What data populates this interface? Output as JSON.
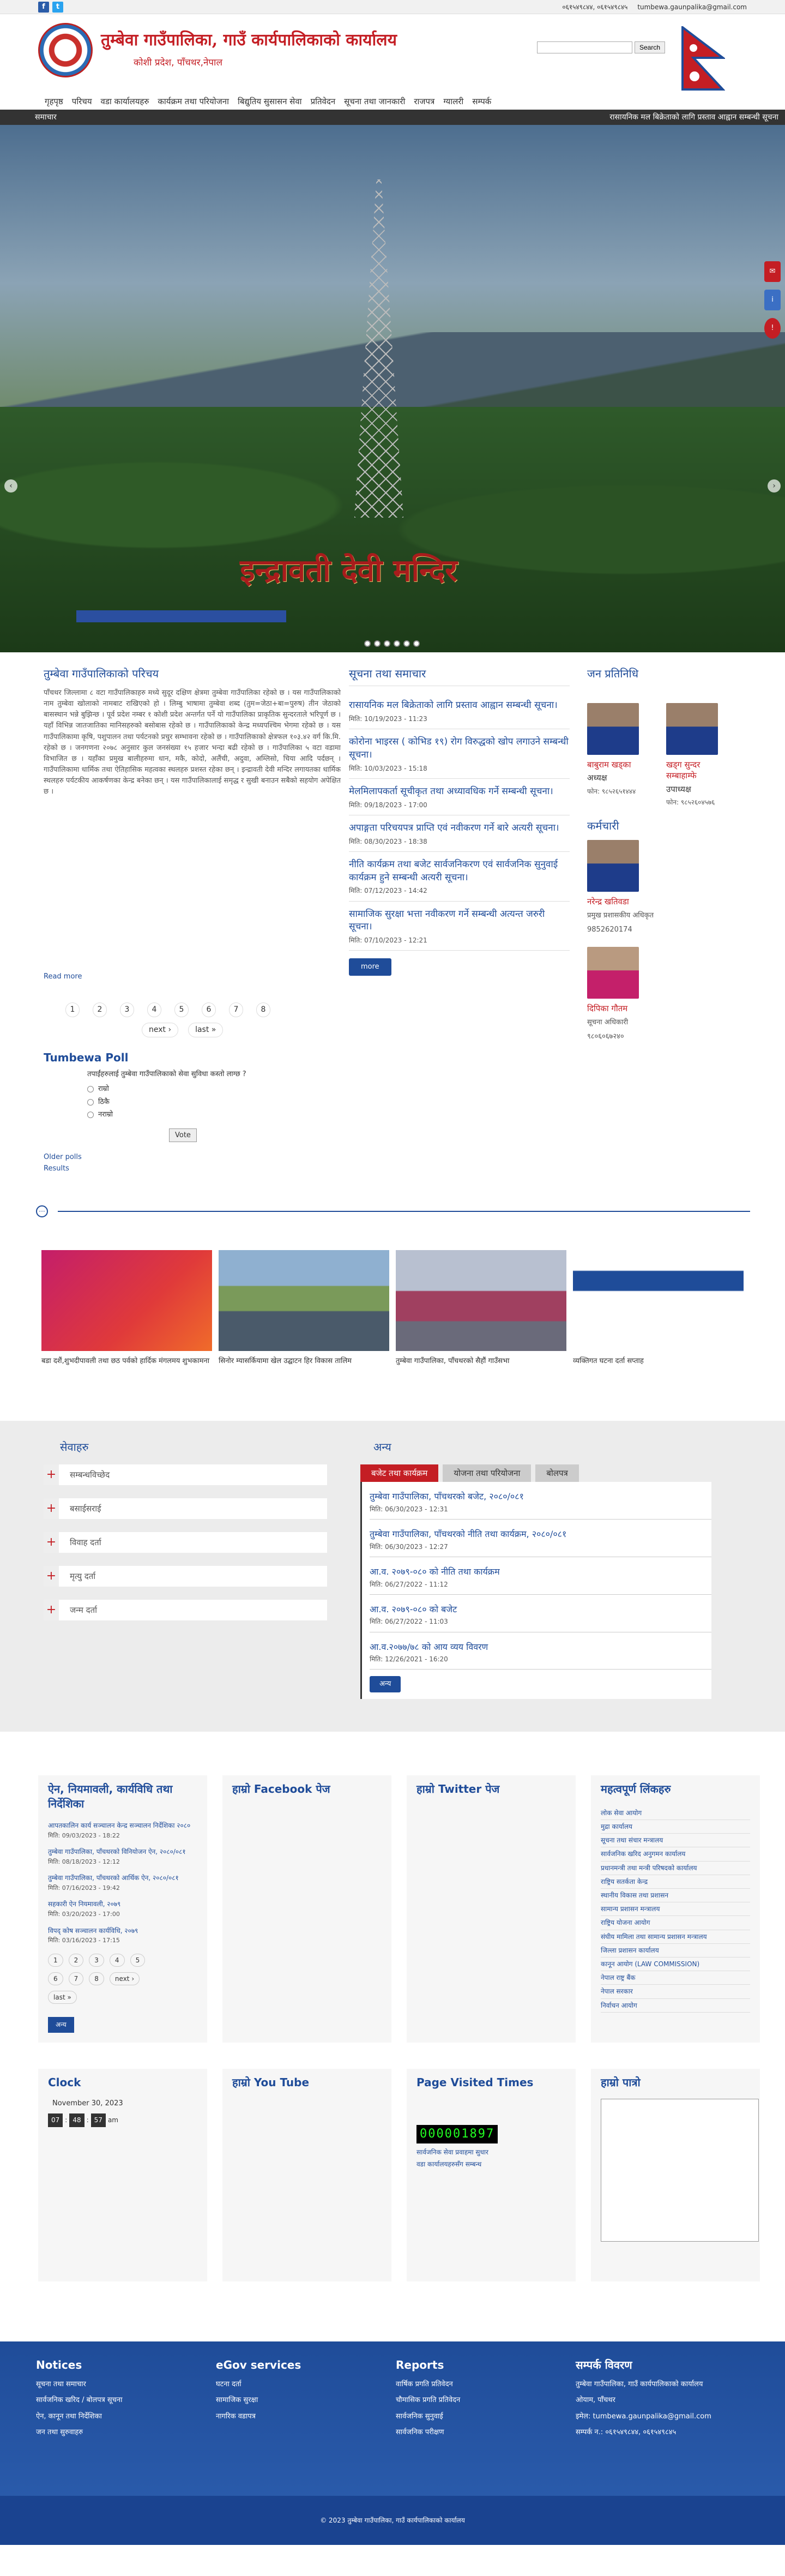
{
  "topbar": {
    "phone": "०६१५४९८४४, ०६१५४९८४५",
    "email": "tumbewa.gaunpalika@gmail.com"
  },
  "header": {
    "title": "तुम्बेवा गाउँपालिका, गाउँ कार्यपालिकाको कार्यालय",
    "subtitle": "कोशी प्रदेश, पाँचथर,नेपाल",
    "search_button": "Search"
  },
  "nav": [
    "गृहपृष्ठ",
    "परिचय",
    "वडा कार्यालयहरु",
    "कार्यक्रम तथा परियोजना",
    "बिद्युतिय सुसासन सेवा",
    "प्रतिवेदन",
    "सूचना तथा जानकारी",
    "राजपत्र",
    "ग्यालरी",
    "सम्पर्क"
  ],
  "ticker": {
    "label": "समाचार",
    "text": "रासायनिक मल बिक्रेताको लागि प्रस्ताव आह्वान सम्बन्धी सूचना"
  },
  "hero": {
    "caption": "इन्द्रावती देवी मन्दिर"
  },
  "intro": {
    "heading": "तुम्बेवा गाउँपालिकाको परिचय",
    "text": "पाँचथर जिल्लामा ८ वटा गाउँपालिकाहरु मध्ये सुदूर दक्षिण क्षेत्रमा तुम्बेवा गाउँपालिका रहेको छ । यस गाउँपालिकाको नाम तुम्बेवा खोलाको नामबाट राखिएको हो । लिम्बु भाषामा तुम्बेवा शब्द (तुम=जेठा+बा=पुरुष) तीन जेठाको बासस्थान भन्ने बुझिन्छ । पूर्व प्रदेश नम्बर १ कोशी प्रदेश अन्तर्गत पर्ने यो गाउँपालिका प्राकृतिक सुन्दरताले भरिपूर्ण छ । यहाँ विभिन्न जातजातिका मानिसहरुको बसोबास रहेको छ । गाउँपालिकाको केन्द्र मध्यपश्चिम भेगमा रहेको छ । यस गाउँपालिकामा कृषि, पशुपालन तथा पर्यटनको प्रचुर सम्भावना रहेको छ । गाउँपालिकाको क्षेत्रफल १०३.४२ वर्ग कि.मि. रहेको छ । जनगणना २०७८ अनुसार कुल जनसंख्या १५ हजार भन्दा बढी रहेको छ । गाउँपालिका ५ वटा वडामा विभाजित छ । यहाँका प्रमुख बालीहरुमा धान, मकै, कोदो, अलैंची, अदुवा, अम्लिसो, चिया आदि पर्दछन् । गाउँपालिकामा धार्मिक तथा ऐतिहासिक महत्वका स्थलहरु प्रशस्त रहेका छन् । इन्द्रावती देवी मन्दिर लगायतका धार्मिक स्थलहरु पर्यटकीय आकर्षणका केन्द्र बनेका छन् । यस गाउँपालिकालाई समृद्ध र सुखी बनाउन सबैको सहयोग अपेक्षित छ ।",
    "more": "Read more"
  },
  "pager": {
    "pages": [
      "1",
      "2",
      "3",
      "4",
      "5",
      "6",
      "7",
      "8"
    ],
    "next": "next ›",
    "last": "last »"
  },
  "poll": {
    "heading": "Tumbewa Poll",
    "question": "तपाईंहरुलाई तुम्बेवा गाउँपालिकाको सेवा सुविधा कस्तो लाग्छ ?",
    "options": [
      "राम्रो",
      "ठिकै",
      "नराम्रो"
    ],
    "vote": "Vote",
    "older": "Older polls",
    "results": "Results"
  },
  "news": {
    "heading": "सूचना तथा समाचार",
    "items": [
      {
        "t": "रासायनिक मल बिक्रेताको लागि प्रस्ताव आह्वान सम्बन्धी सूचना।",
        "d": "मिति: 10/19/2023 - 11:23"
      },
      {
        "t": "कोरोना भाइरस ( कोभिड १९) रोग विरुद्धको खोप लगाउने सम्बन्धी सूचना।",
        "d": "मिति: 10/03/2023 - 15:18"
      },
      {
        "t": "मेलमिलापकर्ता सूचीकृत तथा अध्यावधिक गर्ने सम्बन्धी सूचना।",
        "d": "मिति: 09/18/2023 - 17:00"
      },
      {
        "t": "अपाङ्गता परिचयपत्र प्राप्ति एवं नवीकरण गर्ने बारे अत्यरी सूचना।",
        "d": "मिति: 08/30/2023 - 18:38"
      },
      {
        "t": "नीति कार्यक्रम तथा बजेट सार्वजनिकरण एवं सार्वजनिक सुनुवाई कार्यक्रम हुने सम्बन्धी अत्यरी सूचना।",
        "d": "मिति: 07/12/2023 - 14:42"
      },
      {
        "t": "सामाजिक सुरक्षा भत्ता नवीकरण गर्ने सम्बन्धी अत्यन्त जरुरी सूचना।",
        "d": "मिति: 07/10/2023 - 12:21"
      }
    ],
    "more": "more"
  },
  "reps": {
    "heading": "जन प्रतिनिधि",
    "people": [
      {
        "name": "बाबुराम खड्का",
        "post": "अध्यक्ष",
        "phone": "फोन: ९८५२६५१४४४"
      },
      {
        "name": "खड्ग सुन्दर सम्बाहाम्फे",
        "post": "उपाध्यक्ष",
        "phone": "फोन: ९८५२६०४५७६"
      }
    ]
  },
  "staff": {
    "heading": "कर्मचारी",
    "people": [
      {
        "name": "नरेन्द्र खतिवडा",
        "post": "प्रमुख प्रशासकीय अधिकृत",
        "phone": "9852620174"
      },
      {
        "name": "दिपिका गौतम",
        "post": "सूचना अधिकारी",
        "phone": "९८०६०६७२४०"
      }
    ]
  },
  "gallery": [
    {
      "c": "बडा दशैं,शुभदीपावली तथा छठ पर्वको हार्दिक मंगलमय शुभकामना"
    },
    {
      "c": "सिनोर म्यासर्कियामा खेल उद्घाटन हिर विकास तालिम"
    },
    {
      "c": "तुम्बेवा गाउँपालिका, पाँचथरको सैहौं गाउँसभा"
    },
    {
      "c": "व्यक्तिगत घटना दर्ता सप्ताह"
    }
  ],
  "services": {
    "heading": "सेवाहरु",
    "items": [
      "सम्बन्धविच्छेद",
      "बसाईसराई",
      "विवाह दर्ता",
      "मृत्यु दर्ता",
      "जन्म दर्ता"
    ]
  },
  "other": {
    "heading": "अन्य",
    "tabs": [
      "बजेट तथा कार्यक्रम",
      "योजना तथा परियोजना",
      "बोलपत्र"
    ],
    "items": [
      {
        "t": "तुम्बेवा गाउँपालिका, पाँचथरको बजेट, २०८०/०८१",
        "d": "मिति: 06/30/2023 - 12:31"
      },
      {
        "t": "तुम्बेवा गाउँपालिका, पाँचथरको नीति तथा कार्यक्रम, २०८०/०८१",
        "d": "मिति: 06/30/2023 - 12:27"
      },
      {
        "t": "आ.व. २०७९-०८० को नीति तथा कार्यक्रम",
        "d": "मिति: 06/27/2022 - 11:12"
      },
      {
        "t": "आ.व. २०७९-०८० को बजेट",
        "d": "मिति: 06/27/2022 - 11:03"
      },
      {
        "t": "आ.व.२०७७/७८ को आय व्यय विवरण",
        "d": "मिति: 12/26/2021 - 16:20"
      }
    ],
    "btn": "अन्य"
  },
  "laws": {
    "heading": "ऐन, नियमावली, कार्यविधि तथा निर्देशिका",
    "items": [
      {
        "t": "आपतकालिन कार्य सञ्चालन केन्द्र सञ्चालन निर्देशिका २०८०",
        "d": "मिति: 09/03/2023 - 18:22"
      },
      {
        "t": "तुम्बेवा गाउँपालिका, पाँचथरको विनियोजन ऐन, २०८०/०८१",
        "d": "मिति: 08/18/2023 - 12:12"
      },
      {
        "t": "तुम्बेवा गाउँपालिका, पाँचथरको आर्थिक ऐन, २०८०/०८१",
        "d": "मिति: 07/16/2023 - 19:42"
      },
      {
        "t": "सहकारी ऐन नियमावली, २०७९",
        "d": "मिति: 03/20/2023 - 17:00"
      },
      {
        "t": "विपद् कोष सञ्चालन कार्यविधि, २०७९",
        "d": "मिति: 03/16/2023 - 17:15"
      }
    ],
    "pages": [
      "1",
      "2",
      "3",
      "4",
      "5",
      "6",
      "7",
      "8",
      "next ›",
      "last »"
    ],
    "btn": "अन्य"
  },
  "facebook": {
    "heading": "हाम्रो Facebook पेज"
  },
  "twitter": {
    "heading": "हाम्रो Twitter पेज"
  },
  "links": {
    "heading": "महत्वपूर्ण लिंकहरु",
    "items": [
      "लोक सेवा आयोग",
      "मुद्रा कार्यालय",
      "सूचना तथा संचार मन्त्रालय",
      "सार्वजनिक खरिद अनुगमन कार्यालय",
      "प्रधानमन्त्री तथा मन्त्री परिषदको कार्यालय",
      "राष्ट्रिय सतर्कता केन्द्र",
      "स्थानीय विकास तथा प्रशासन",
      "सामान्य प्रशासन मन्त्रालय",
      "राष्ट्रिय योजना आयोग",
      "संघीय मामिला तथा सामान्य प्रशासन मन्त्रालय",
      "जिल्ला प्रशासन कार्यालय",
      "कानून आयोग (LAW COMMISSION)",
      "नेपाल राष्ट्र बैंक",
      "नेपाल सरकार",
      "निर्वाचन आयोग"
    ]
  },
  "clock": {
    "heading": "Clock",
    "date": "November 30, 2023",
    "h": "07",
    "m": "48",
    "s": "57",
    "ampm": "am"
  },
  "youtube": {
    "heading": "हाम्रो You Tube"
  },
  "visits": {
    "heading": "Page Visited Times",
    "count": "000001897",
    "l1": "सार्वजनिक सेवा प्रवाहमा सुधार",
    "l2": "वडा कार्यालयहरुसँग सम्बन्ध"
  },
  "patro": {
    "heading": "हाम्रो पात्रो"
  },
  "footer": {
    "cols": [
      {
        "h": "Notices",
        "items": [
          "सूचना तथा समाचार",
          "सार्वजनिक खरिद / बोलपत्र सूचना",
          "ऐन, कानून तथा निर्देशिका",
          "जन तथा सुरुवाहरु"
        ]
      },
      {
        "h": "eGov services",
        "items": [
          "घटना दर्ता",
          "सामाजिक सुरक्षा",
          "नागरिक वडापत्र"
        ]
      },
      {
        "h": "Reports",
        "items": [
          "वार्षिक प्रगति प्रतिवेदन",
          "चौमासिक प्रगति प्रतिवेदन",
          "सार्वजनिक सुनुवाई",
          "सार्वजनिक परीक्षण"
        ]
      },
      {
        "h": "सम्पर्क विवरण",
        "items": [
          "तुम्बेवा गाउँपालिका, गाउँ कार्यपालिकाको कार्यालय",
          "ओयाम, पाँचथर",
          "इमेल: tumbewa.gaunpalika@gmail.com",
          "सम्पर्क न.: ०६१५४९८४४, ०६१५४९८४५"
        ]
      }
    ],
    "copy": "© 2023 तुम्बेवा गाउँपालिका, गाउँ कार्यपालिकाको कार्यालय"
  },
  "colors": {
    "brand_red": "#c41e24",
    "brand_blue": "#1f4c99"
  }
}
